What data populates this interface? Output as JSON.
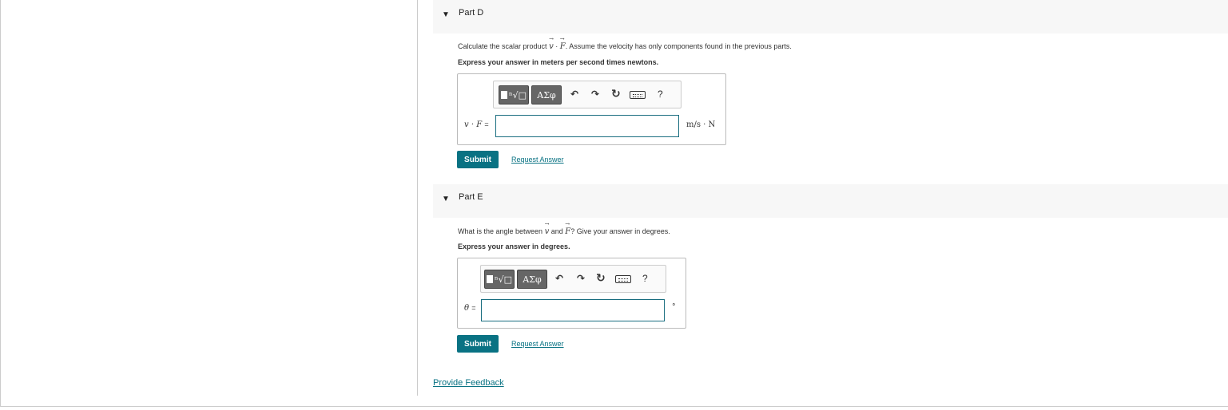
{
  "partD": {
    "header": "Part D",
    "question_prefix": "Calculate the scalar product ",
    "vec_v": "v",
    "dot": "·",
    "vec_F": "F",
    "question_suffix": ". Assume the velocity has only components found in the previous parts.",
    "instruction": "Express your answer in meters per second times newtons.",
    "label_eq": "=",
    "input_value": "",
    "unit": "m/s · N",
    "submit_label": "Submit",
    "request_label": "Request Answer"
  },
  "partE": {
    "header": "Part E",
    "question_prefix": "What is the angle between ",
    "vec_v": "v",
    "and": " and ",
    "vec_F": "F",
    "question_suffix": "? Give your answer in degrees.",
    "instruction": "Express your answer in degrees.",
    "label_var": "θ",
    "label_eq": "=",
    "input_value": "",
    "unit": "°",
    "submit_label": "Submit",
    "request_label": "Request Answer"
  },
  "toolbar": {
    "template_glyph": "ⁿ√□",
    "greek_label": "ΑΣφ",
    "undo_icon": "undo-icon",
    "redo_icon": "redo-icon",
    "reset_icon": "reset-icon",
    "keyboard_icon": "keyboard-icon",
    "help_label": "?"
  },
  "footer": {
    "feedback_label": "Provide Feedback"
  }
}
